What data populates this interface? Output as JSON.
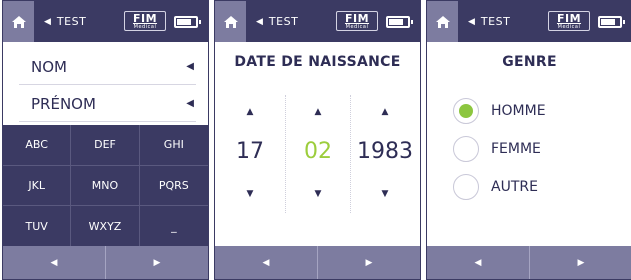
{
  "colors": {
    "primary": "#3b3a63",
    "secondary": "#7d7ca0",
    "accent": "#8cc63f"
  },
  "header": {
    "back_arrow": "◀",
    "crumb": "TEST",
    "logo": "FIM",
    "logo_sub": "Medical",
    "home_icon": "home-icon",
    "battery_level": 0.8
  },
  "screen1": {
    "fields": [
      {
        "label": "NOM",
        "arrow": "◀"
      },
      {
        "label": "PRÉNOM",
        "arrow": "◀"
      }
    ],
    "keys": [
      "ABC",
      "DEF",
      "GHI",
      "JKL",
      "MNO",
      "PQRS",
      "TUV",
      "WXYZ",
      "_"
    ]
  },
  "screen2": {
    "title": "DATE DE NAISSANCE",
    "up": "▲",
    "down": "▼",
    "day": "17",
    "month": "02",
    "year": "1983"
  },
  "screen3": {
    "title": "GENRE",
    "options": [
      "HOMME",
      "FEMME",
      "AUTRE"
    ],
    "selected": "HOMME"
  },
  "nav": {
    "prev": "◀",
    "next": "▶"
  }
}
